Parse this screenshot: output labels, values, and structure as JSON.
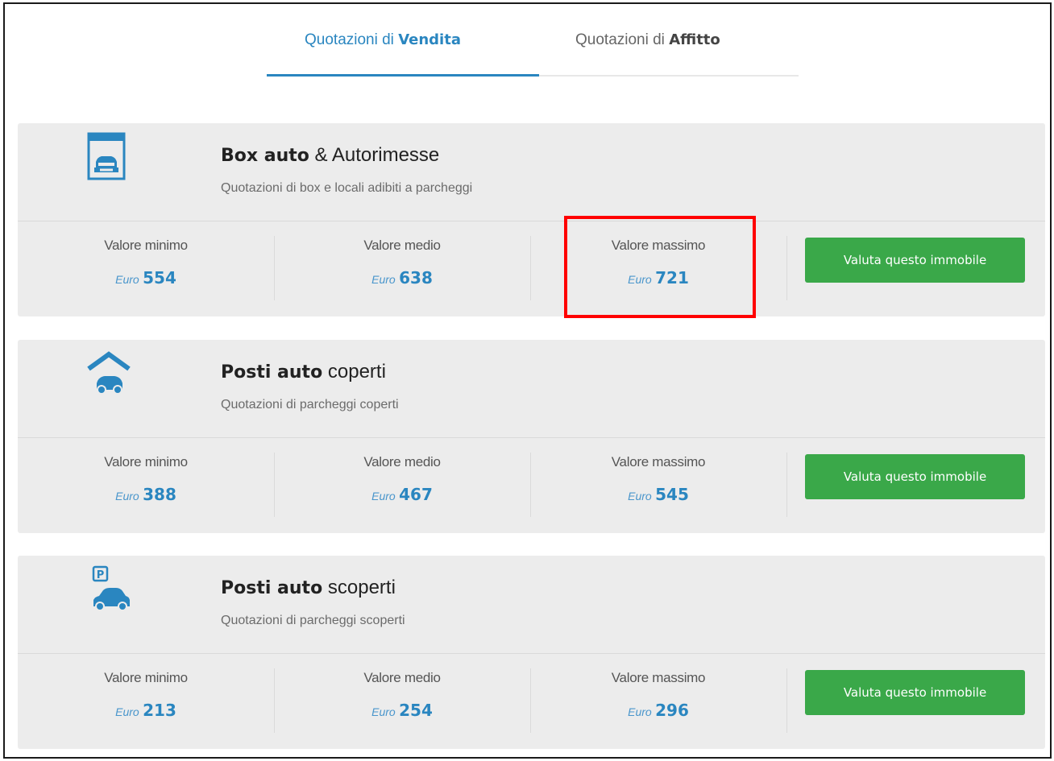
{
  "tabs": [
    {
      "prefix": "Quotazioni di ",
      "bold": "Vendita",
      "active": true
    },
    {
      "prefix": "Quotazioni di ",
      "bold": "Affitto",
      "active": false
    }
  ],
  "colors": {
    "accent": "#2a86c0",
    "card_bg": "#ececec",
    "button": "#3aa849",
    "highlight": "#ff0000"
  },
  "cards": [
    {
      "icon": "garage-box-icon",
      "title_bold": "Box auto",
      "title_rest": " & Autorimesse",
      "subtitle": "Quotazioni di box e locali adibiti a parcheggi",
      "min_label": "Valore minimo",
      "min_unit": "Euro",
      "min_value": "554",
      "avg_label": "Valore medio",
      "avg_unit": "Euro",
      "avg_value": "638",
      "max_label": "Valore massimo",
      "max_unit": "Euro",
      "max_value": "721",
      "button": "Valuta questo immobile"
    },
    {
      "icon": "covered-parking-icon",
      "title_bold": "Posti auto",
      "title_rest": " coperti",
      "subtitle": "Quotazioni di parcheggi coperti",
      "min_label": "Valore minimo",
      "min_unit": "Euro",
      "min_value": "388",
      "avg_label": "Valore medio",
      "avg_unit": "Euro",
      "avg_value": "467",
      "max_label": "Valore massimo",
      "max_unit": "Euro",
      "max_value": "545",
      "button": "Valuta questo immobile"
    },
    {
      "icon": "open-parking-icon",
      "title_bold": "Posti auto",
      "title_rest": " scoperti",
      "subtitle": "Quotazioni di parcheggi scoperti",
      "min_label": "Valore minimo",
      "min_unit": "Euro",
      "min_value": "213",
      "avg_label": "Valore medio",
      "avg_unit": "Euro",
      "avg_value": "254",
      "max_label": "Valore massimo",
      "max_unit": "Euro",
      "max_value": "296",
      "button": "Valuta questo immobile"
    }
  ],
  "parking_sign": "P"
}
